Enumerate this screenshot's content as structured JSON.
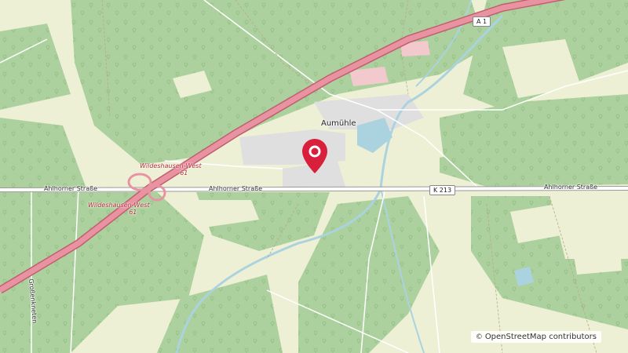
{
  "map": {
    "places": {
      "village": "Aumühle",
      "locality_vertical": "Großenkneten"
    },
    "roads": {
      "motorway_shield": "A 1",
      "county_shield": "K 213",
      "street_left": "Ahlhorner Straße",
      "street_middle": "Ahlhorner Straße",
      "street_right": "Ahlhorner Straße"
    },
    "junctions": [
      {
        "name": "Wildeshausen-West",
        "number": "61"
      },
      {
        "name": "Wildeshausen-West",
        "number": "61"
      }
    ],
    "marker": {
      "icon": "map-pin-icon",
      "color": "#d81f3c"
    },
    "attribution": {
      "symbol": "©",
      "text": "OpenStreetMap contributors"
    },
    "colors": {
      "forest": "#add19e",
      "farmland": "#eef0d5",
      "motorway": "#e892a2",
      "residential": "#e0dfdf"
    }
  }
}
